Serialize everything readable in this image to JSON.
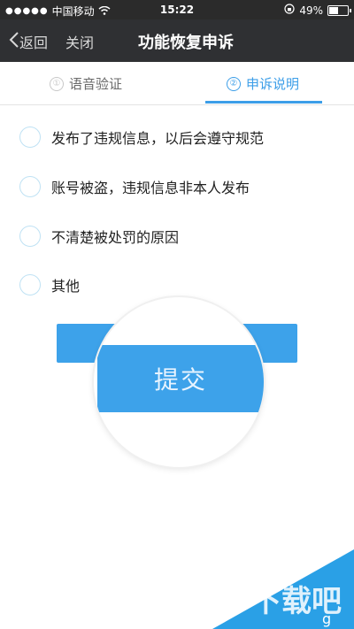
{
  "status": {
    "carrier": "中国移动",
    "time": "15:22",
    "battery_text": "49%",
    "battery_level": 0.49
  },
  "nav": {
    "back_label": "返回",
    "close_label": "关闭",
    "title": "功能恢复申诉"
  },
  "tabs": [
    {
      "marker": "①",
      "label": "语音验证"
    },
    {
      "marker": "②",
      "label": "申诉说明"
    }
  ],
  "options": [
    "发布了违规信息，以后会遵守规范",
    "账号被盗，违规信息非本人发布",
    "不清楚被处罚的原因",
    "其他"
  ],
  "submit": {
    "label": "提交"
  },
  "watermark": {
    "text": "下载吧",
    "partial": "g"
  },
  "colors": {
    "accent": "#3da2ea",
    "navbar": "#2f3033"
  }
}
